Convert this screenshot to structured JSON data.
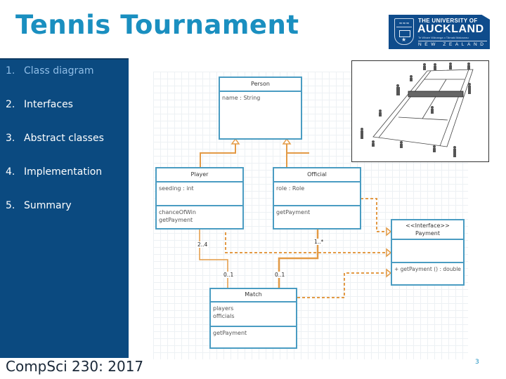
{
  "header": {
    "title": "Tennis Tournament",
    "logo": {
      "line1": "THE UNIVERSITY OF",
      "line2": "AUCKLAND",
      "line3": "Te Whare Wānanga o Tāmaki Makaurau",
      "line4": "NEW ZEALAND"
    }
  },
  "sidebar": {
    "items": [
      {
        "num": "1.",
        "label": "Class diagram",
        "active": true
      },
      {
        "num": "2.",
        "label": "Interfaces",
        "active": false
      },
      {
        "num": "3.",
        "label": "Abstract classes",
        "active": false
      },
      {
        "num": "4.",
        "label": "Implementation",
        "active": false
      },
      {
        "num": "5.",
        "label": "Summary",
        "active": false
      }
    ]
  },
  "diagram": {
    "classes": {
      "person": {
        "name": "Person",
        "attributes": [
          "name : String"
        ],
        "methods": []
      },
      "player": {
        "name": "Player",
        "attributes": [
          "seeding : int"
        ],
        "methods": [
          "chanceOfWin",
          "getPayment"
        ]
      },
      "official": {
        "name": "Official",
        "attributes": [
          "role : Role"
        ],
        "methods": [
          "getPayment"
        ]
      },
      "payment": {
        "stereotype": "<<Interface>>",
        "name": "Payment",
        "attributes": [],
        "methods": [
          "+ getPayment () : double"
        ]
      },
      "match": {
        "name": "Match",
        "attributes": [
          "players",
          "officials"
        ],
        "methods": [
          "getPayment"
        ]
      }
    },
    "multiplicities": {
      "player_end": "2..4",
      "official_end": "1..*",
      "match_player_end": "0..1",
      "match_official_end": "0..1"
    },
    "colors": {
      "class_border": "#4a9cc2",
      "connector": "#e39a45"
    }
  },
  "image": {
    "alt": "Tennis court sketch with players and officials"
  },
  "footer": {
    "course": "CompSci 230: 2017",
    "page": "3"
  }
}
